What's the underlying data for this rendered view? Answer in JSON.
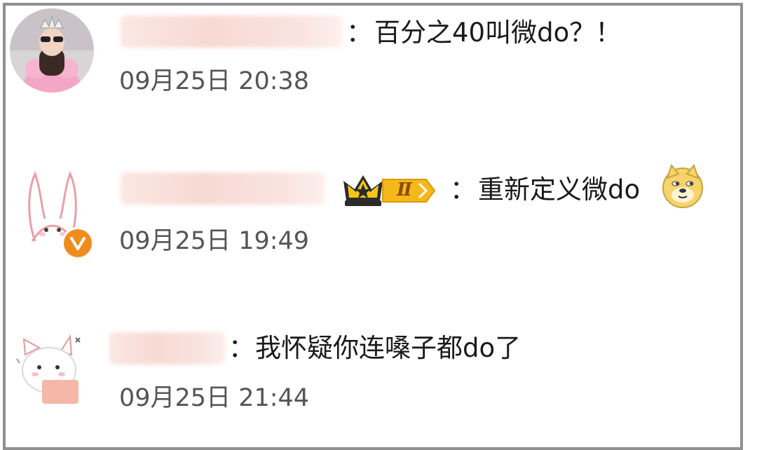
{
  "comments": [
    {
      "avatar": "tiara-girl-avatar",
      "separator": "：",
      "text": "百分之40叫微do？！",
      "time": "09月25日 20:38"
    },
    {
      "avatar": "bunny-avatar",
      "badge": "verified-v-icon",
      "crown_level": "Ⅱ",
      "separator": "：",
      "text": "重新定义微do",
      "emoji": "doge-emoji",
      "time": "09月25日 19:49"
    },
    {
      "avatar": "cat-avatar",
      "separator": "：",
      "text": "我怀疑你连嗓子都do了",
      "time": "09月25日 21:44"
    }
  ],
  "colors": {
    "border": "#8f8f8f",
    "text": "#1a1a1a",
    "time": "#555555",
    "badge_orange": "#f08c1e",
    "crown_gold": "#f5c518"
  }
}
